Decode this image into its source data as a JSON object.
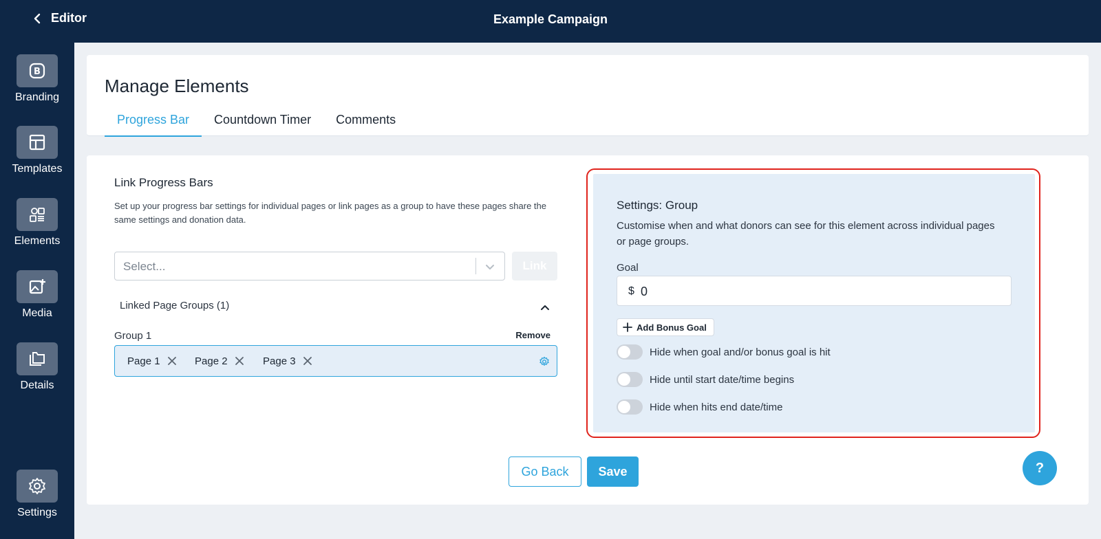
{
  "topbar": {
    "back_label": "Editor",
    "title": "Example Campaign"
  },
  "sidebar": {
    "items": [
      {
        "label": "Branding",
        "icon": "branding-icon"
      },
      {
        "label": "Templates",
        "icon": "templates-icon"
      },
      {
        "label": "Elements",
        "icon": "elements-icon"
      },
      {
        "label": "Media",
        "icon": "media-icon"
      },
      {
        "label": "Details",
        "icon": "details-icon"
      },
      {
        "label": "Settings",
        "icon": "gear-icon"
      }
    ]
  },
  "header": {
    "title": "Manage Elements",
    "tabs": [
      {
        "label": "Progress Bar",
        "active": true
      },
      {
        "label": "Countdown Timer",
        "active": false
      },
      {
        "label": "Comments",
        "active": false
      }
    ]
  },
  "link_section": {
    "title": "Link Progress Bars",
    "description": "Set up your progress bar settings for individual pages or link pages as a group to have these pages share the same settings and donation data.",
    "select_placeholder": "Select...",
    "link_button": "Link",
    "linked_groups_label": "Linked Page Groups (1)",
    "group": {
      "name": "Group 1",
      "remove_label": "Remove",
      "pages": [
        "Page 1",
        "Page 2",
        "Page 3"
      ]
    }
  },
  "settings": {
    "title": "Settings: Group",
    "description": "Customise when and what donors can see for this element across individual pages or page groups.",
    "goal_label": "Goal",
    "goal_currency": "$",
    "goal_value": "0",
    "bonus_button": "Add Bonus Goal",
    "toggles": [
      {
        "label": "Hide when goal and/or bonus goal is hit",
        "on": false
      },
      {
        "label": "Hide until start date/time begins",
        "on": false
      },
      {
        "label": "Hide when hits end date/time",
        "on": false
      }
    ],
    "highlight_color": "#e0231c"
  },
  "footer": {
    "back_button": "Go Back",
    "save_button": "Save"
  },
  "help_button": "?",
  "colors": {
    "accent": "#2ea4dc",
    "navy": "#0e2746"
  }
}
